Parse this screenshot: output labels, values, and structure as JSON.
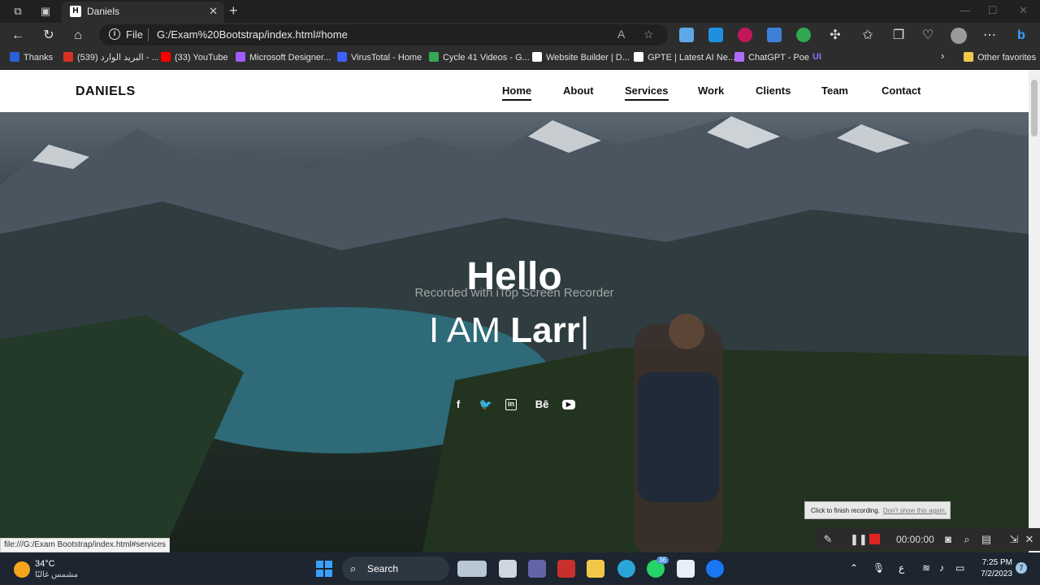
{
  "browser": {
    "tab_title": "Daniels",
    "tab_favicon": "H",
    "address_prefix": "File",
    "url": "G:/Exam%20Bootstrap/index.html#home",
    "bookmarks": [
      {
        "label": "Thanks",
        "color": "#2b5fd9"
      },
      {
        "label": "(539) البريد الوارد - ...",
        "color": "#d93025"
      },
      {
        "label": "(33) YouTube",
        "color": "#ff0000"
      },
      {
        "label": "Microsoft Designer...",
        "color": "#a05cff"
      },
      {
        "label": "VirusTotal - Home",
        "color": "#3b61ff"
      },
      {
        "label": "Cycle 41 Videos - G...",
        "color": "#34a853"
      },
      {
        "label": "Website Builder | D...",
        "color": "#ffffff"
      },
      {
        "label": "GPTE | Latest AI Ne...",
        "color": "#ffffff"
      },
      {
        "label": "ChatGPT - Poe",
        "color": "#b36bff"
      }
    ],
    "other_favorites": "Other favorites",
    "status_url": "file:///G:/Exam Bootstrap/index.html#services"
  },
  "site": {
    "brand": "DANIELS",
    "nav": [
      "Home",
      "About",
      "Services",
      "Work",
      "Clients",
      "Team",
      "Contact"
    ],
    "hero_title": "Hello",
    "watermark": "Recorded with iTop Screen Recorder",
    "typed_prefix": "I AM ",
    "typed_name": "Larr",
    "typed_cursor": "|",
    "social_icons": [
      "facebook-icon",
      "twitter-icon",
      "linkedin-icon",
      "behance-icon",
      "youtube-icon"
    ]
  },
  "recorder": {
    "tooltip": "Click to finish recording.",
    "tooltip_link": "Don't show this again.",
    "time": "00:00:00"
  },
  "taskbar": {
    "temperature": "34°C",
    "weather_desc": "مشمس غالبًا",
    "search_label": "Search",
    "badge_count": "36",
    "lang": "ع",
    "time": "7:25 PM",
    "date": "7/2/2023",
    "notifications": "7"
  }
}
